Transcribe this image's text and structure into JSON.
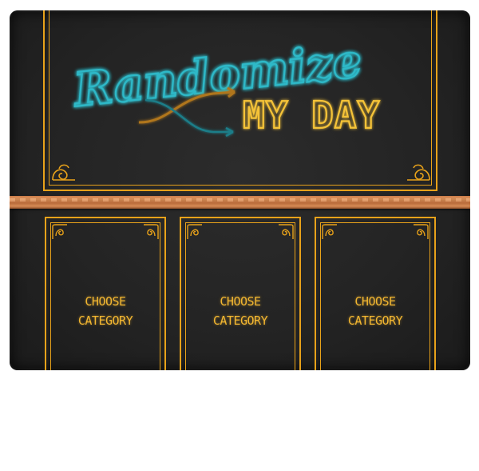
{
  "sign": {
    "title_line1": "Randomize",
    "title_line2": "MY DAY"
  },
  "cards": [
    {
      "label": "CHOOSE\nCATEGORY"
    },
    {
      "label": "CHOOSE\nCATEGORY"
    },
    {
      "label": "CHOOSE\nCATEGORY"
    }
  ],
  "colors": {
    "board": "#252525",
    "gold": "#e8a21a",
    "neon_teal": "#2fb9c8",
    "neon_yellow": "#f5c338",
    "copper": "#d08650"
  }
}
